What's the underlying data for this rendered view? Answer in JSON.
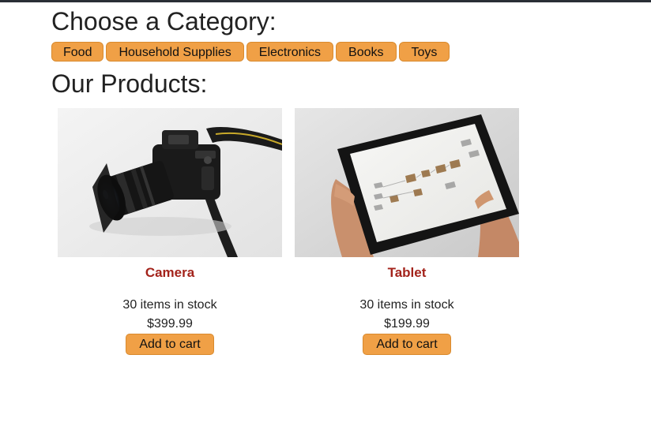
{
  "categories": {
    "title": "Choose a Category:",
    "items": [
      "Food",
      "Household Supplies",
      "Electronics",
      "Books",
      "Toys"
    ]
  },
  "products": {
    "title": "Our Products:",
    "items": [
      {
        "name": "Camera",
        "stock": "30 items in stock",
        "price": "$399.99",
        "button": "Add to cart",
        "image_icon": "camera-photo"
      },
      {
        "name": "Tablet",
        "stock": "30 items in stock",
        "price": "$199.99",
        "button": "Add to cart",
        "image_icon": "tablet-photo"
      }
    ]
  },
  "colors": {
    "accent": "#f0a046",
    "product_name": "#a3231b",
    "top_bar": "#2a2f36"
  }
}
